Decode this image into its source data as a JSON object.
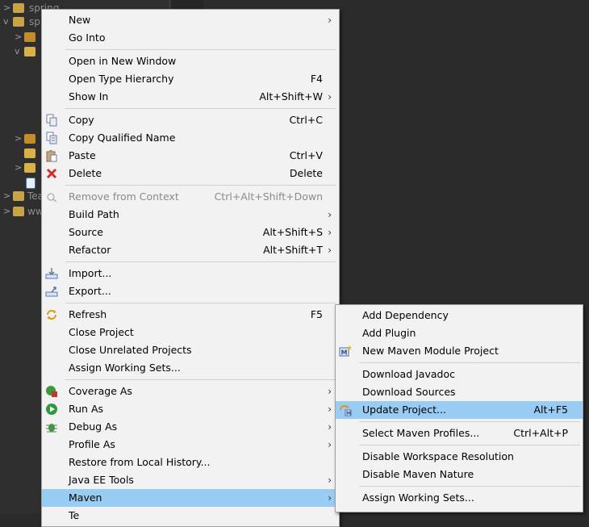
{
  "tree": {
    "items": [
      {
        "label": "spring"
      },
      {
        "label": "spr"
      },
      {
        "label": "Tea"
      },
      {
        "label": "www"
      }
    ]
  },
  "menu": {
    "items": [
      {
        "label": "New",
        "shortcut": "",
        "submenu": true
      },
      {
        "label": "Go Into",
        "shortcut": ""
      },
      {
        "label": "Open in New Window",
        "shortcut": ""
      },
      {
        "label": "Open Type Hierarchy",
        "shortcut": "F4"
      },
      {
        "label": "Show In",
        "shortcut": "Alt+Shift+W",
        "submenu": true
      },
      {
        "label": "Copy",
        "shortcut": "Ctrl+C",
        "icon": "copy-icon"
      },
      {
        "label": "Copy Qualified Name",
        "shortcut": "",
        "icon": "copy-qualified-icon"
      },
      {
        "label": "Paste",
        "shortcut": "Ctrl+V",
        "icon": "paste-icon"
      },
      {
        "label": "Delete",
        "shortcut": "Delete",
        "icon": "delete-icon"
      },
      {
        "label": "Remove from Context",
        "shortcut": "Ctrl+Alt+Shift+Down",
        "disabled": true,
        "icon": "remove-context-icon"
      },
      {
        "label": "Build Path",
        "shortcut": "",
        "submenu": true
      },
      {
        "label": "Source",
        "shortcut": "Alt+Shift+S",
        "submenu": true
      },
      {
        "label": "Refactor",
        "shortcut": "Alt+Shift+T",
        "submenu": true
      },
      {
        "label": "Import...",
        "shortcut": "",
        "icon": "import-icon"
      },
      {
        "label": "Export...",
        "shortcut": "",
        "icon": "export-icon"
      },
      {
        "label": "Refresh",
        "shortcut": "F5",
        "icon": "refresh-icon"
      },
      {
        "label": "Close Project",
        "shortcut": ""
      },
      {
        "label": "Close Unrelated Projects",
        "shortcut": ""
      },
      {
        "label": "Assign Working Sets...",
        "shortcut": ""
      },
      {
        "label": "Coverage As",
        "shortcut": "",
        "submenu": true,
        "icon": "coverage-icon"
      },
      {
        "label": "Run As",
        "shortcut": "",
        "submenu": true,
        "icon": "run-icon"
      },
      {
        "label": "Debug As",
        "shortcut": "",
        "submenu": true,
        "icon": "debug-icon"
      },
      {
        "label": "Profile As",
        "shortcut": "",
        "submenu": true
      },
      {
        "label": "Restore from Local History...",
        "shortcut": ""
      },
      {
        "label": "Java EE Tools",
        "shortcut": "",
        "submenu": true
      },
      {
        "label": "Maven",
        "shortcut": "",
        "submenu": true,
        "highlighted": true
      },
      {
        "label": "Te",
        "shortcut": ""
      }
    ]
  },
  "submenu": {
    "items": [
      {
        "label": "Add Dependency",
        "shortcut": ""
      },
      {
        "label": "Add Plugin",
        "shortcut": ""
      },
      {
        "label": "New Maven Module Project",
        "shortcut": "",
        "icon": "maven-module-icon"
      },
      {
        "label": "Download Javadoc",
        "shortcut": ""
      },
      {
        "label": "Download Sources",
        "shortcut": ""
      },
      {
        "label": "Update Project...",
        "shortcut": "Alt+F5",
        "highlighted": true,
        "icon": "update-project-icon"
      },
      {
        "label": "Select Maven Profiles...",
        "shortcut": "Ctrl+Alt+P"
      },
      {
        "label": "Disable Workspace Resolution",
        "shortcut": ""
      },
      {
        "label": "Disable Maven Nature",
        "shortcut": ""
      },
      {
        "label": "Assign Working Sets...",
        "shortcut": ""
      }
    ]
  },
  "colors": {
    "menu_bg": "#f2f2f2",
    "highlight": "#99ccf3",
    "ide_bg": "#2b2b2b"
  }
}
